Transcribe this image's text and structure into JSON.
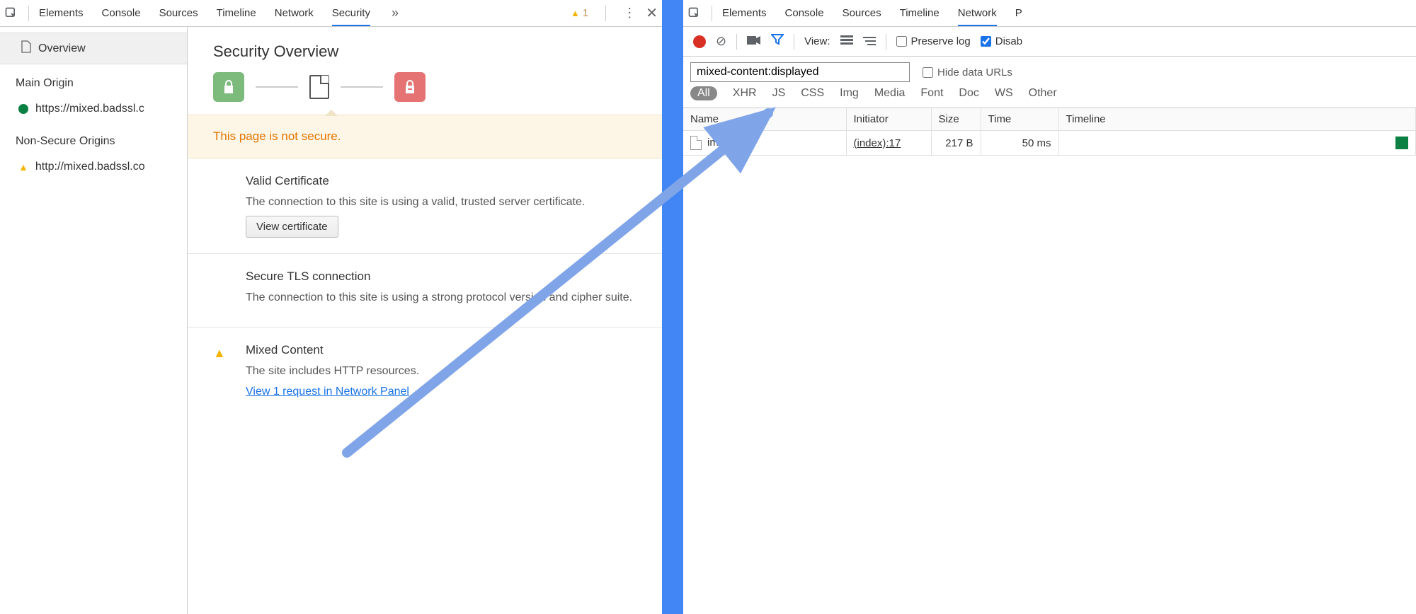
{
  "left_toolbar": {
    "tabs": [
      "Elements",
      "Console",
      "Sources",
      "Timeline",
      "Network",
      "Security"
    ],
    "active_tab": "Security",
    "overflow": "»",
    "warning_count": "1",
    "menu_glyph": "⋮",
    "close_glyph": "✕"
  },
  "security_sidebar": {
    "overview_label": "Overview",
    "main_origin_header": "Main Origin",
    "main_origin_item": "https://mixed.badssl.c",
    "non_secure_header": "Non-Secure Origins",
    "non_secure_item": "http://mixed.badssl.co"
  },
  "security_main": {
    "title": "Security Overview",
    "banner": "This page is not secure.",
    "blocks": [
      {
        "status": "green",
        "heading": "Valid Certificate",
        "body": "The connection to this site is using a valid, trusted server certificate.",
        "button": "View certificate"
      },
      {
        "status": "green",
        "heading": "Secure TLS connection",
        "body": "The connection to this site is using a strong protocol version and cipher suite."
      },
      {
        "status": "warn",
        "heading": "Mixed Content",
        "body": "The site includes HTTP resources.",
        "link": "View 1 request in Network Panel"
      }
    ]
  },
  "right_toolbar": {
    "tabs": [
      "Elements",
      "Console",
      "Sources",
      "Timeline",
      "Network",
      "P"
    ],
    "active_tab": "Network"
  },
  "net_controls": {
    "view_label": "View:",
    "preserve_log": "Preserve log",
    "disable_cache": "Disab"
  },
  "net_filter": {
    "filter_value": "mixed-content:displayed",
    "hide_data_urls": "Hide data URLs",
    "types": [
      "All",
      "XHR",
      "JS",
      "CSS",
      "Img",
      "Media",
      "Font",
      "Doc",
      "WS",
      "Other"
    ]
  },
  "net_table": {
    "headers": [
      "Name",
      "Initiator",
      "Size",
      "Time",
      "Timeline"
    ],
    "rows": [
      {
        "name": "image.jpg",
        "initiator": "(index):17",
        "size": "217 B",
        "time": "50 ms"
      }
    ]
  }
}
